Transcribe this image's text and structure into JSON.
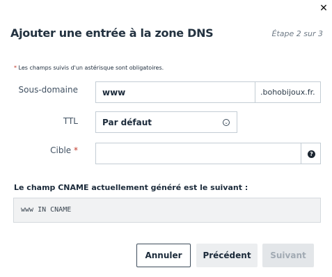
{
  "dialog": {
    "close_icon": "close-icon",
    "title": "Ajouter une entrée à la zone DNS",
    "step": "Étape 2 sur 3",
    "required_note_star": "*",
    "required_note": " Les champs suivis d'un astérisque sont obligatoires."
  },
  "form": {
    "subdomain_label": "Sous-domaine",
    "subdomain_value": "www",
    "subdomain_suffix": ".bohobijoux.fr.",
    "ttl_label": "TTL",
    "ttl_value": "Par défaut",
    "ttl_chevron": "chevron-down-icon",
    "target_label": "Cible",
    "target_required": "*",
    "target_value": "",
    "help_icon": "help-icon"
  },
  "cname": {
    "title": "Le champ CNAME actuellement généré est le suivant :",
    "value": "www IN CNAME"
  },
  "buttons": {
    "cancel": "Annuler",
    "previous": "Précédent",
    "next": "Suivant"
  }
}
